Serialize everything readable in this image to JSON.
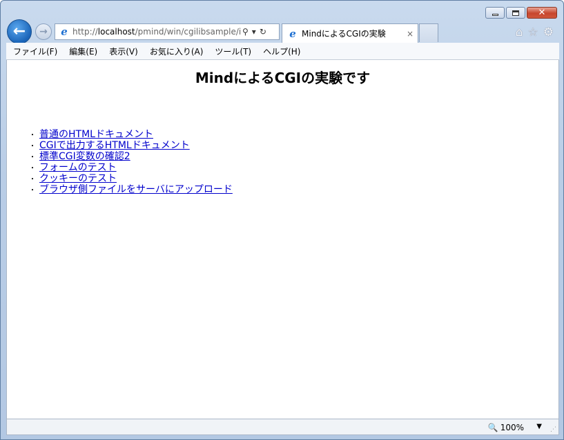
{
  "browser": {
    "address": {
      "prefix": "http://",
      "host": "localhost",
      "path": "/pmind/win/cgilibsample/i"
    },
    "tab": {
      "title": "MindによるCGIの実験",
      "close": "×"
    },
    "menu": [
      "ファイル(F)",
      "編集(E)",
      "表示(V)",
      "お気に入り(A)",
      "ツール(T)",
      "ヘルプ(H)"
    ],
    "zoom": "100%"
  },
  "page": {
    "title": "MindによるCGIの実験です",
    "links": [
      "普通のHTMLドキュメント",
      "CGIで出力するHTMLドキュメント",
      "標準CGI変数の確認2",
      "フォームのテスト",
      "クッキーのテスト",
      "ブラウザ側ファイルをサーバにアップロード"
    ]
  },
  "icons": [
    "minimize-icon",
    "maximize-icon",
    "close-icon",
    "back-arrow-icon",
    "forward-arrow-icon",
    "ie-logo-icon",
    "search-icon",
    "dropdown-icon",
    "refresh-icon",
    "home-icon",
    "favorites-star-icon",
    "gear-icon",
    "zoom-icon"
  ]
}
